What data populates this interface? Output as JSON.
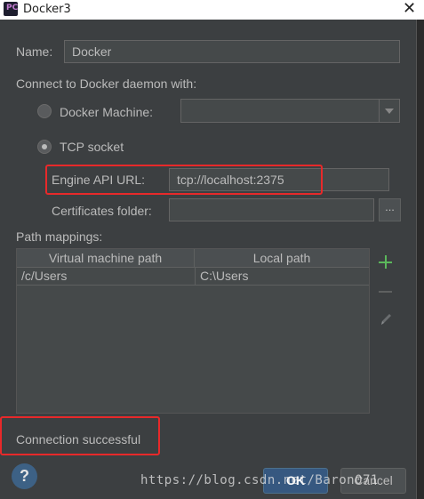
{
  "window": {
    "title": "Docker3",
    "close_glyph": "✕"
  },
  "form": {
    "name_label": "Name:",
    "name_value": "Docker",
    "connect_label": "Connect to Docker daemon with:",
    "docker_machine_label": "Docker Machine:",
    "docker_machine_value": "",
    "tcp_socket_label": "TCP socket",
    "engine_api_label": "Engine API URL:",
    "engine_api_value": "tcp://localhost:2375",
    "certificates_label": "Certificates folder:",
    "certificates_value": "",
    "browse_label": "...",
    "selected_connection": "TCP socket"
  },
  "path_mappings": {
    "label": "Path mappings:",
    "columns": [
      "Virtual machine path",
      "Local path"
    ],
    "rows": [
      [
        "/c/Users",
        "C:\\Users"
      ]
    ]
  },
  "status": {
    "message": "Connection successful"
  },
  "buttons": {
    "help": "?",
    "ok": "OK",
    "cancel": "Cancel"
  },
  "watermark": "https://blog.csdn.net/Baron071",
  "colors": {
    "background": "#3c3f41",
    "field": "#45494a",
    "highlight": "#e8292a",
    "add_icon": "#5bb85b",
    "ok_button": "#365880"
  },
  "icons": {
    "app": "pycharm-app-icon",
    "add": "plus-icon",
    "remove": "minus-icon",
    "edit": "pencil-icon",
    "help": "question-icon",
    "dropdown": "chevron-down-icon"
  }
}
